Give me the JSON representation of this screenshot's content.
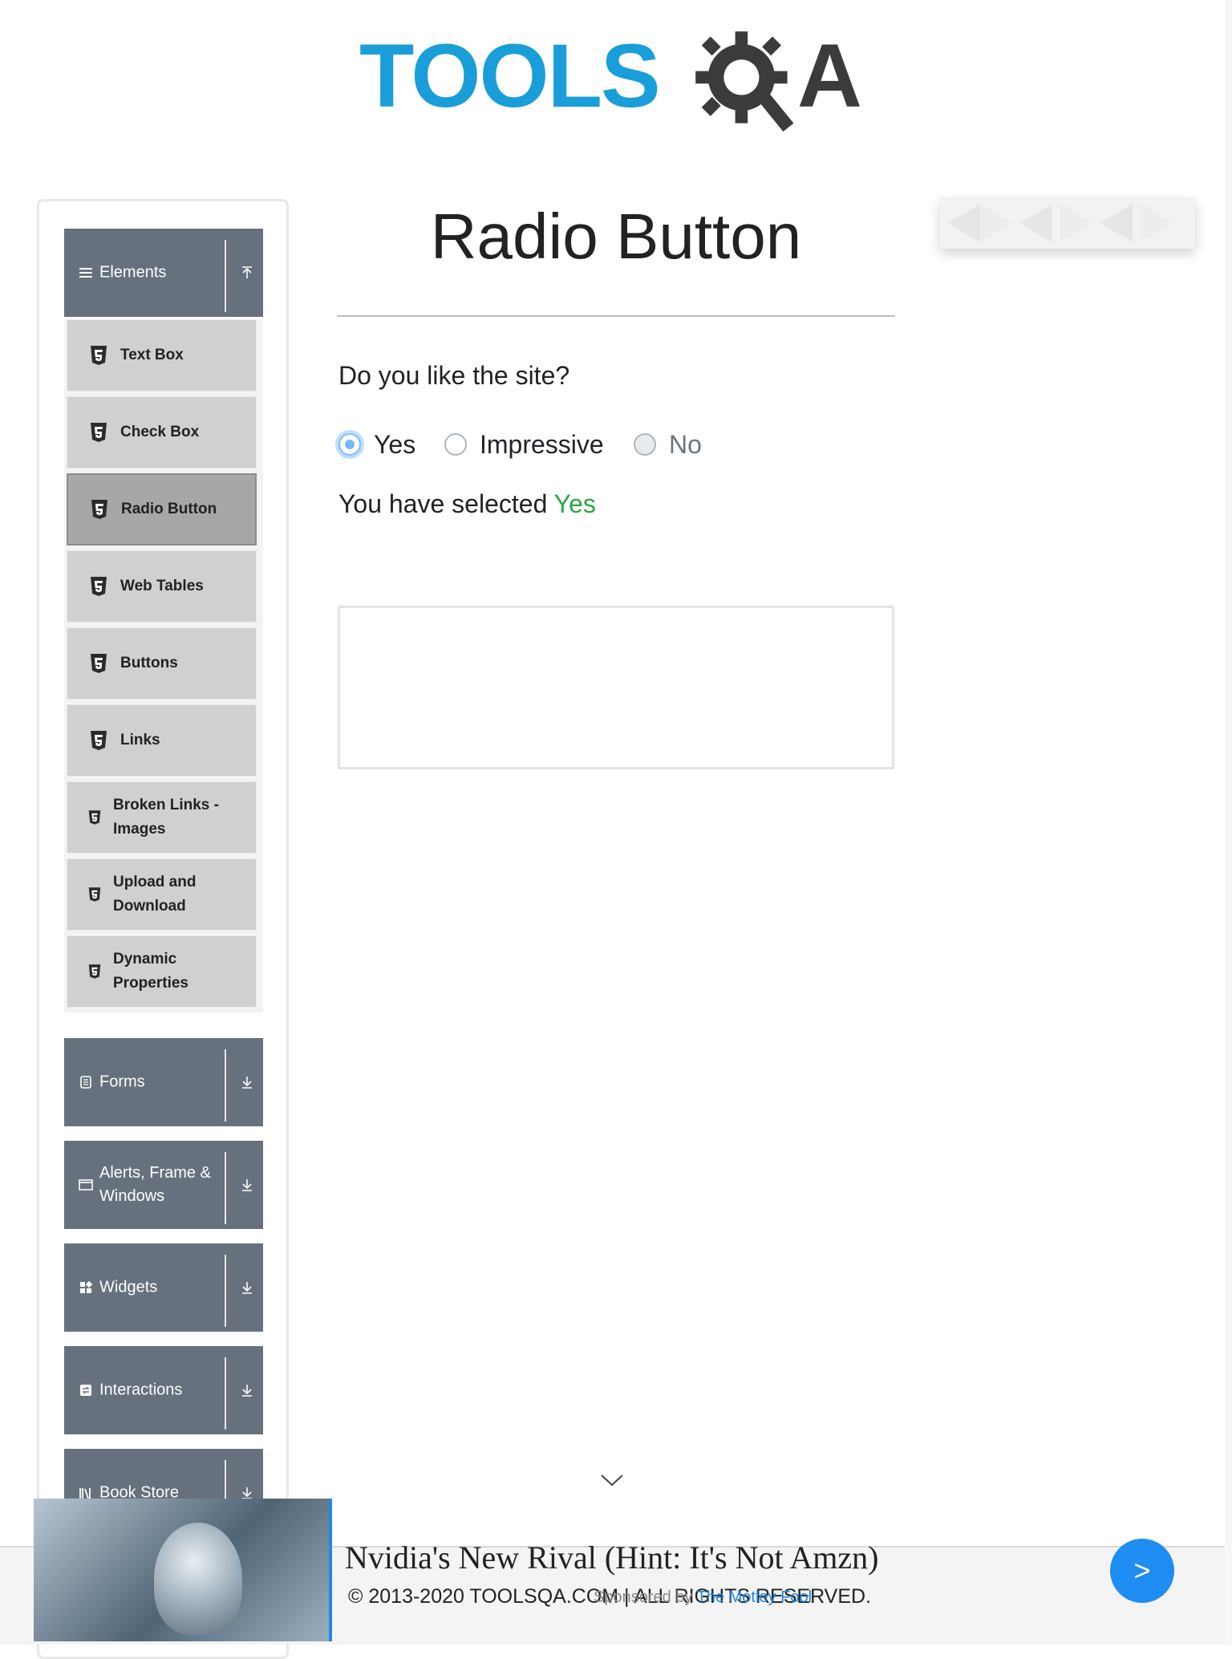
{
  "logo": {
    "part1": "TOOLS",
    "part2": "A"
  },
  "sidebar": {
    "elements_header": "Elements",
    "elements_items": [
      {
        "label": "Text Box"
      },
      {
        "label": "Check Box"
      },
      {
        "label": "Radio Button",
        "active": true
      },
      {
        "label": "Web Tables"
      },
      {
        "label": "Buttons"
      },
      {
        "label": "Links"
      },
      {
        "label": "Broken Links - Images"
      },
      {
        "label": "Upload and Download"
      },
      {
        "label": "Dynamic Properties"
      }
    ],
    "groups": [
      {
        "label": "Forms",
        "icon": "form-icon"
      },
      {
        "label": "Alerts, Frame & Windows",
        "icon": "window-icon"
      },
      {
        "label": "Widgets",
        "icon": "widgets-icon"
      },
      {
        "label": "Interactions",
        "icon": "interactions-icon"
      },
      {
        "label": "Book Store",
        "icon": "book-icon"
      }
    ]
  },
  "main": {
    "title": "Radio Button",
    "question": "Do you like the site?",
    "options": [
      {
        "label": "Yes",
        "state": "checked"
      },
      {
        "label": "Impressive",
        "state": "unchecked"
      },
      {
        "label": "No",
        "state": "disabled"
      }
    ],
    "result_prefix": "You have selected",
    "result_value": "Yes"
  },
  "footer": {
    "copyright": "© 2013-2020 TOOLSQA.COM | ALL RIGHTS RESERVED."
  },
  "ad": {
    "headline": "Nvidia's New Rival (Hint: It's Not Amzn)",
    "sponsored_prefix": "Sponsored by",
    "sponsor": "The Motley Fool",
    "button": ">"
  },
  "colors": {
    "sidebar_header": "#67717d",
    "brand_blue": "#1a9ed9",
    "result_green": "#28a745"
  }
}
